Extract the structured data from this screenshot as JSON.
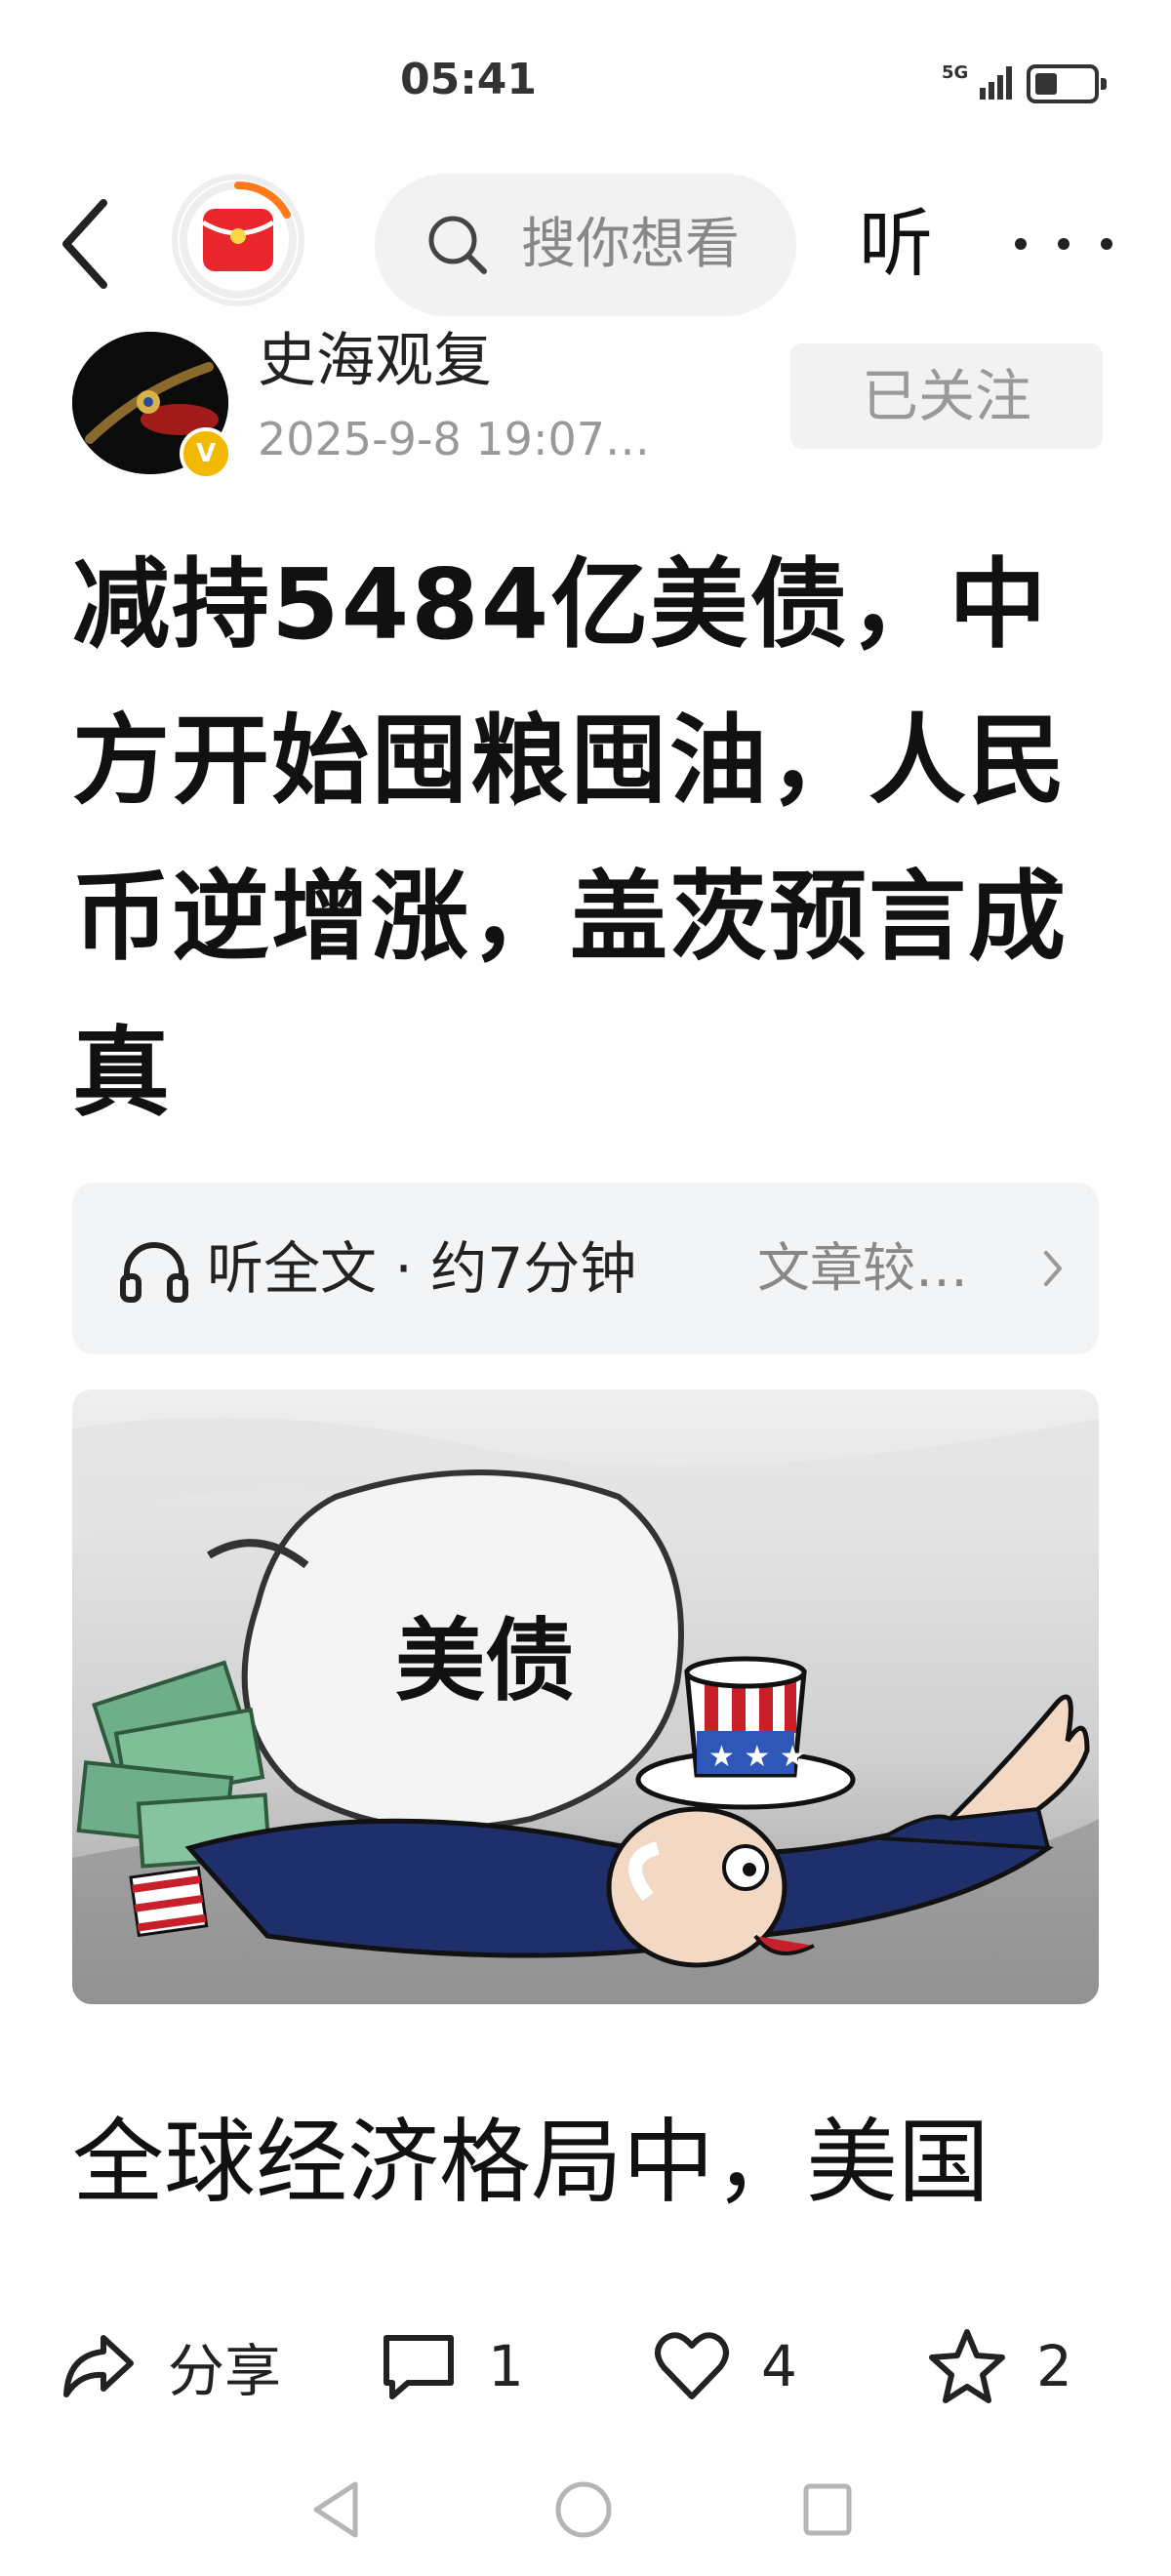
{
  "status_bar": {
    "time": "05:41",
    "network": "5G"
  },
  "nav": {
    "search_placeholder": "搜你想看",
    "listen_label": "听"
  },
  "author": {
    "name": "史海观复",
    "date": "2025-9-8  19:07…",
    "verified_badge": "V",
    "follow_label": "已关注"
  },
  "article": {
    "title": "减持5484亿美债，中方开始囤粮囤油，人民币逆增涨，盖茨预言成真",
    "listen_banner": {
      "label": "听全文 · 约7分钟",
      "subtext": "文章较…"
    },
    "image_text": "美债",
    "first_paragraph": "全球经济格局中，美国"
  },
  "actions": {
    "share_label": "分享",
    "comment_count": "1",
    "like_count": "4",
    "favorite_count": "2"
  },
  "colors": {
    "accent_red": "#e8262c",
    "ring_orange": "#ff7a1a",
    "badge_gold": "#f3b800"
  }
}
